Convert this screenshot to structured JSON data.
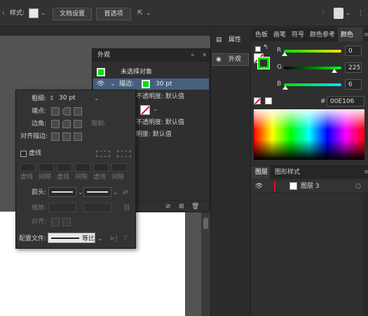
{
  "control_bar": {
    "style_label": "样式:",
    "doc_setup_label": "文档设置",
    "prefs_label": "首选项"
  },
  "appearance": {
    "title": "外观",
    "no_selection": "未选择对象",
    "stroke_label": "描边:",
    "stroke_value": "30 pt",
    "opacity_label_1": "不透明度: 默认值",
    "opacity_label_2": "不透明度: 默认值",
    "opacity_label_3": "明度: 默认值"
  },
  "stroke_panel": {
    "weight_label": "粗细:",
    "weight_value": "30 pt",
    "cap_label": "端点:",
    "corner_label": "边角:",
    "limit_label": "限制:",
    "align_label": "对齐描边:",
    "dashed_label": "虚线",
    "dash_labels": [
      "虚线",
      "间隙",
      "虚线",
      "间隙",
      "虚线",
      "间隙"
    ],
    "arrow_label": "箭头:",
    "scale_label": "缩放:",
    "align2_label": "对齐:",
    "profile_label": "配置文件:",
    "profile_value": "等比"
  },
  "side_dock": {
    "properties_label": "属性",
    "appearance_label": "外观"
  },
  "color_panel": {
    "tabs": [
      "色板",
      "画笔",
      "符号",
      "颜色参考",
      "颜色"
    ],
    "active_tab": "颜色",
    "r_label": "R",
    "r_value": "0",
    "g_label": "G",
    "g_value": "225",
    "b_label": "B",
    "b_value": "6",
    "hex_label": "#",
    "hex_value": "00E106",
    "fill_color": "#00e106"
  },
  "layers_panel": {
    "tabs": [
      "图层",
      "图形样式"
    ],
    "layer_name": "图层 3"
  }
}
